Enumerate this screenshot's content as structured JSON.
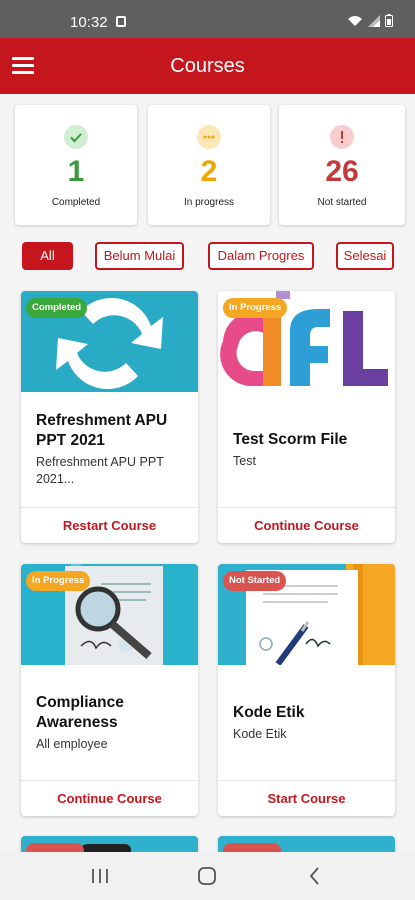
{
  "status_bar": {
    "time": "10:32"
  },
  "app_bar": {
    "title": "Courses"
  },
  "stats": [
    {
      "count": "1",
      "label": "Completed",
      "icon": "check-icon",
      "color": "#3a9a3a",
      "bg": "#cfeed2"
    },
    {
      "count": "2",
      "label": "In progress",
      "icon": "dots-icon",
      "color": "#f0a500",
      "bg": "#fde6b5"
    },
    {
      "count": "26",
      "label": "Not started",
      "icon": "exclamation-icon",
      "color": "#c33a3a",
      "bg": "#f8cdcd"
    }
  ],
  "filters": [
    {
      "label": "All",
      "active": true
    },
    {
      "label": "Belum Mulai",
      "active": false
    },
    {
      "label": "Dalam Progres",
      "active": false
    },
    {
      "label": "Selesai",
      "active": false
    }
  ],
  "courses": [
    {
      "badge": "Completed",
      "badge_color": "#3aa83a",
      "title": "Refreshment APU PPT 2021",
      "description": "Refreshment APU PPT 2021...",
      "action": "Restart Course"
    },
    {
      "badge": "In Progress",
      "badge_color": "#f5a623",
      "title": "Test Scorm File",
      "description": "Test",
      "action": "Continue Course"
    },
    {
      "badge": "In Progress",
      "badge_color": "#f5a623",
      "title": "Compliance Awareness",
      "description": "All employee",
      "action": "Continue Course"
    },
    {
      "badge": "Not Started",
      "badge_color": "#d9534f",
      "title": "Kode Etik",
      "description": "Kode Etik",
      "action": "Start Course"
    }
  ]
}
